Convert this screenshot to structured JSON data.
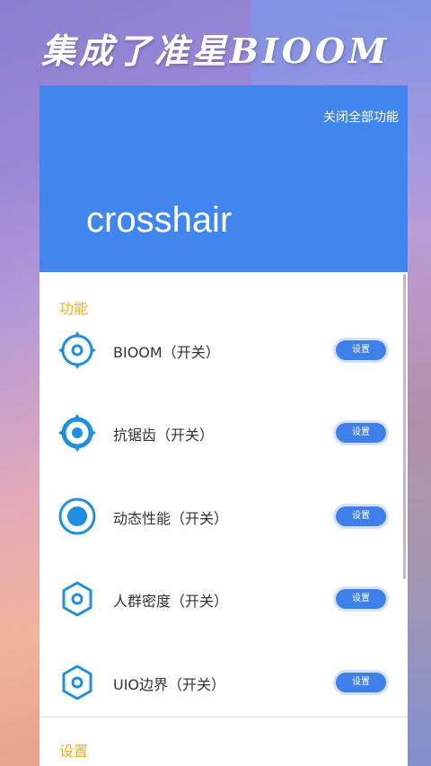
{
  "headline": "集成了准星BIOOM",
  "header": {
    "close_all": "关闭全部功能",
    "app_title": "crosshair"
  },
  "sections": {
    "features": "功能",
    "settings": "设置"
  },
  "items": [
    {
      "label": "BIOOM（开关）",
      "button": "设置",
      "icon": "crosshair-ring-icon"
    },
    {
      "label": "抗锯齿（开关）",
      "button": "设置",
      "icon": "crosshair-dot-icon"
    },
    {
      "label": "动态性能（开关）",
      "button": "设置",
      "icon": "record-circle-icon"
    },
    {
      "label": "人群密度（开关）",
      "button": "设置",
      "icon": "hexagon-icon"
    },
    {
      "label": "UIO边界（开关）",
      "button": "设置",
      "icon": "hexagon-icon"
    }
  ],
  "colors": {
    "accent": "#4086ee",
    "section": "#f2b01e",
    "icon": "#1f8fe0"
  }
}
